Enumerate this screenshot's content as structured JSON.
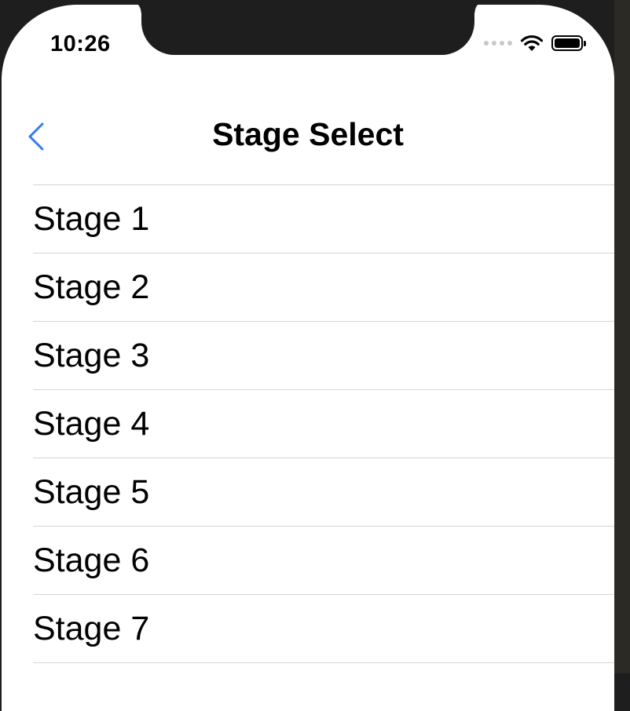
{
  "status_bar": {
    "time": "10:26",
    "signal_icon": "cellular-dots-icon",
    "wifi_icon": "wifi-icon",
    "battery_icon": "battery-icon",
    "battery_level": 1.0
  },
  "navbar": {
    "title": "Stage Select",
    "back_icon": "chevron-left-icon",
    "accent_color": "#3478f6"
  },
  "stages": [
    {
      "label": "Stage 1"
    },
    {
      "label": "Stage 2"
    },
    {
      "label": "Stage 3"
    },
    {
      "label": "Stage 4"
    },
    {
      "label": "Stage 5"
    },
    {
      "label": "Stage 6"
    },
    {
      "label": "Stage 7"
    }
  ]
}
